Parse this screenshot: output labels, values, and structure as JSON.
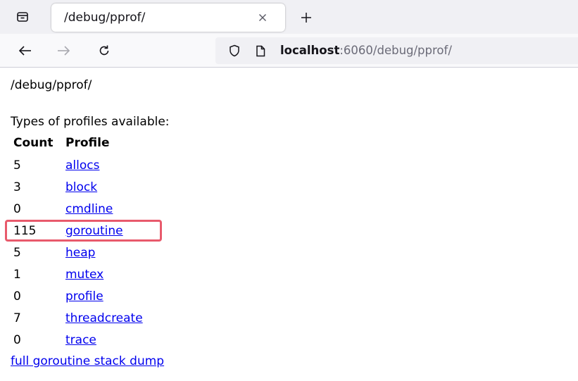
{
  "browser": {
    "tab": {
      "title": "/debug/pprof/"
    },
    "url": {
      "host": "localhost",
      "rest": ":6060/debug/pprof/"
    },
    "icons": {
      "tabs_list": "tabs-list-icon",
      "close": "close-icon",
      "new_tab": "plus-icon",
      "back": "back-arrow-icon",
      "forward": "forward-arrow-icon",
      "reload": "reload-icon",
      "shield": "shield-icon",
      "page": "page-icon"
    }
  },
  "page": {
    "heading": "/debug/pprof/",
    "types_label": "Types of profiles available:",
    "columns": {
      "count": "Count",
      "profile": "Profile"
    },
    "profiles": [
      {
        "count": "5",
        "name": "allocs"
      },
      {
        "count": "3",
        "name": "block"
      },
      {
        "count": "0",
        "name": "cmdline"
      },
      {
        "count": "115",
        "name": "goroutine"
      },
      {
        "count": "5",
        "name": "heap"
      },
      {
        "count": "1",
        "name": "mutex"
      },
      {
        "count": "0",
        "name": "profile"
      },
      {
        "count": "7",
        "name": "threadcreate"
      },
      {
        "count": "0",
        "name": "trace"
      }
    ],
    "full_dump_link": "full goroutine stack dump",
    "highlight": {
      "row": "goroutine",
      "color": "#e85a6c"
    },
    "link_color": "#0000ee"
  }
}
